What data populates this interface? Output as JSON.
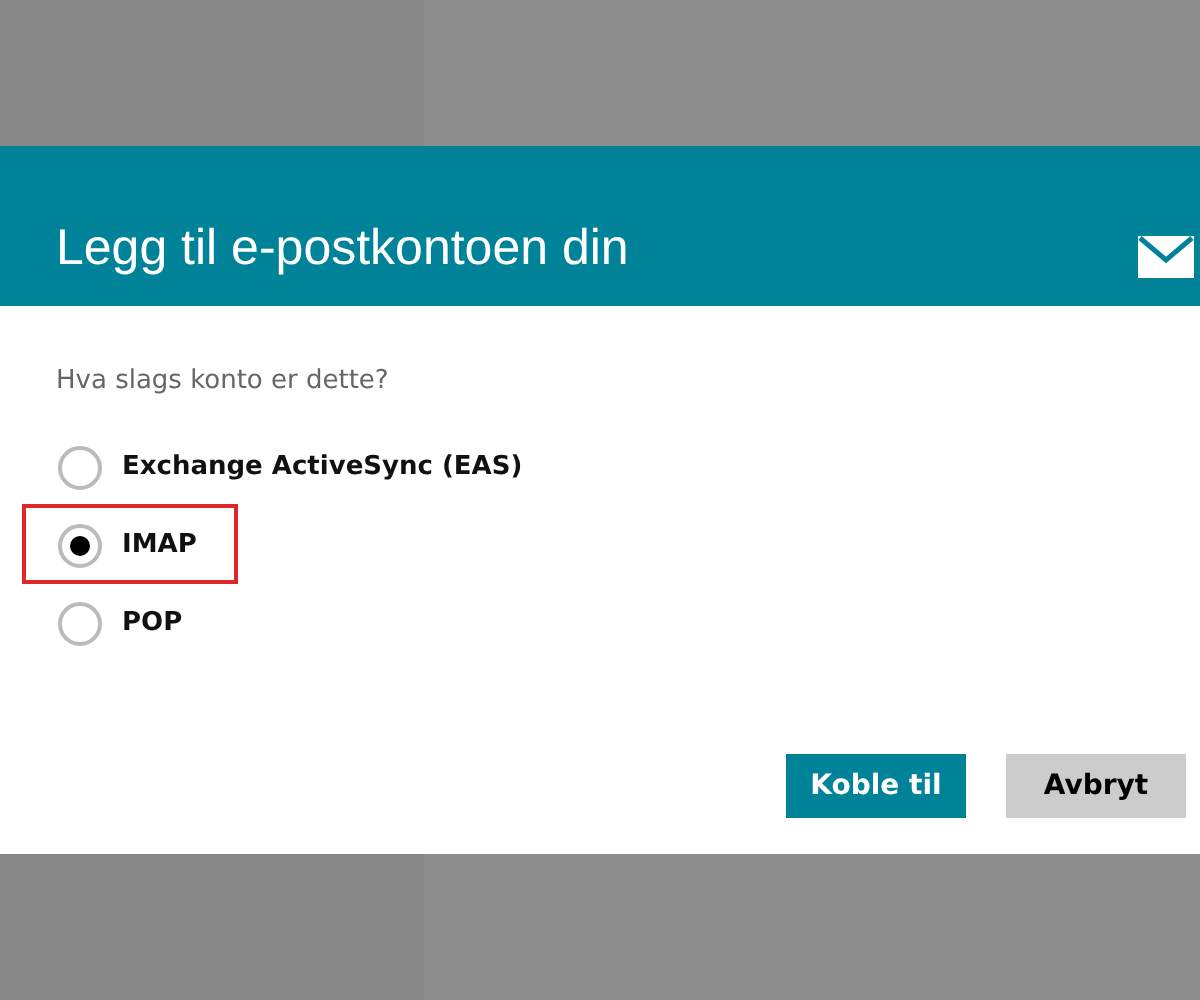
{
  "dialog": {
    "title": "Legg til e-postkontoen din",
    "question": "Hva slags konto er dette?",
    "options": [
      {
        "label": "Exchange ActiveSync (EAS)",
        "selected": false,
        "highlighted": false
      },
      {
        "label": "IMAP",
        "selected": true,
        "highlighted": true
      },
      {
        "label": "POP",
        "selected": false,
        "highlighted": false
      }
    ],
    "buttons": [
      {
        "label": "Koble til",
        "kind": "primary"
      },
      {
        "label": "Avbryt",
        "kind": "secondary"
      }
    ]
  }
}
